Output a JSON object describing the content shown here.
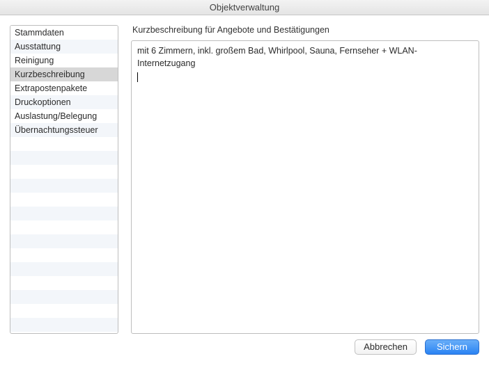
{
  "window": {
    "title": "Objektverwaltung"
  },
  "sidebar": {
    "items": [
      {
        "label": "Stammdaten",
        "active": false
      },
      {
        "label": "Ausstattung",
        "active": false
      },
      {
        "label": "Reinigung",
        "active": false
      },
      {
        "label": "Kurzbeschreibung",
        "active": true
      },
      {
        "label": "Extrapostenpakete",
        "active": false
      },
      {
        "label": "Druckoptionen",
        "active": false
      },
      {
        "label": "Auslastung/Belegung",
        "active": false
      },
      {
        "label": "Übernachtungssteuer",
        "active": false
      }
    ],
    "total_rows": 22
  },
  "main": {
    "section_label": "Kurzbeschreibung für Angebote und Bestätigungen",
    "editor_text": "mit 6 Zimmern, inkl. großem Bad, Whirlpool, Sauna, Fernseher + WLAN-Internetzugang"
  },
  "footer": {
    "cancel_label": "Abbrechen",
    "save_label": "Sichern"
  }
}
